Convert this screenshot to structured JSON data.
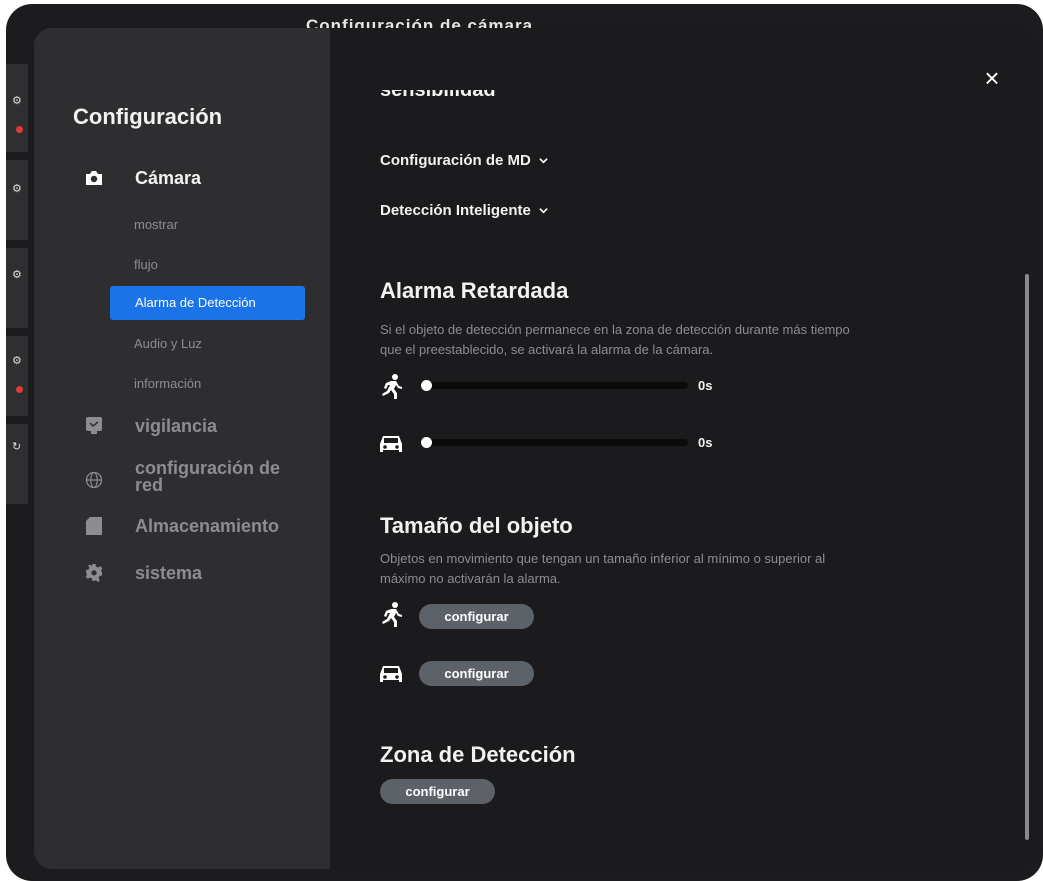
{
  "background": {
    "title_fragment": "Configuración de cámara"
  },
  "sidebar": {
    "title": "Configuración",
    "nav": [
      {
        "label": "Cámara",
        "icon": "camera-icon",
        "active": true
      },
      {
        "label": "vigilancia",
        "icon": "monitor-icon"
      },
      {
        "label": "configuración de red",
        "icon": "globe-icon"
      },
      {
        "label": "Almacenamiento",
        "icon": "sd-card-icon"
      },
      {
        "label": "sistema",
        "icon": "gear-icon"
      }
    ],
    "camera_sub": [
      "mostrar",
      "flujo",
      "Alarma de Detección",
      "Audio y Luz",
      "información"
    ],
    "active_sub": "Alarma de Detección"
  },
  "content": {
    "sensitivity_header": "sensibilidad",
    "md_config": "Configuración de MD",
    "smart_detection": "Detección Inteligente",
    "delayed_alarm": {
      "title": "Alarma Retardada",
      "description": "Si el objeto de detección permanece en la zona de detección durante más tiempo que el preestablecido, se activará la alarma de la cámara.",
      "person_value": "0s",
      "vehicle_value": "0s",
      "person_level": 0,
      "vehicle_level": 0
    },
    "object_size": {
      "title": "Tamaño del objeto",
      "description": "Objetos en movimiento que tengan un tamaño inferior al mínimo o superior al máximo no activarán la alarma.",
      "person_button": "configurar",
      "vehicle_button": "configurar"
    },
    "detection_zone": {
      "title": "Zona de Detección",
      "button": "configurar"
    }
  },
  "colors": {
    "accent": "#1a73e8",
    "button": "#5d6168",
    "sidebar_bg": "#2e2e30",
    "content_bg": "#1b1b1d"
  },
  "icons": {
    "close": "×"
  }
}
